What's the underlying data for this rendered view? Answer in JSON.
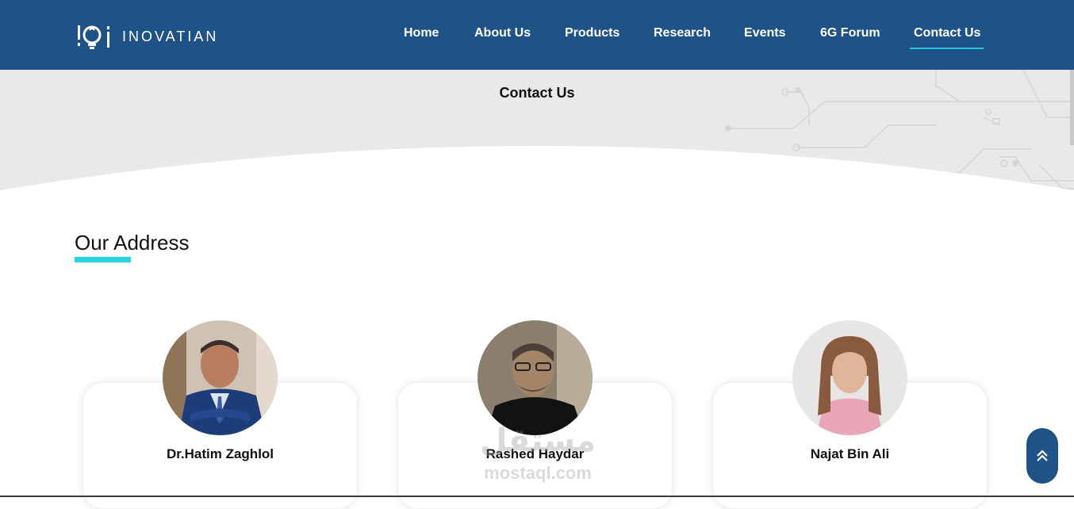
{
  "brand": {
    "name": "INOVATIAN",
    "logo_icon": "lightbulb-logo-icon"
  },
  "nav": {
    "items": [
      {
        "label": "Home"
      },
      {
        "label": "About Us"
      },
      {
        "label": "Products"
      },
      {
        "label": "Research"
      },
      {
        "label": "Events"
      },
      {
        "label": "6G Forum"
      },
      {
        "label": "Contact Us",
        "active": true
      }
    ]
  },
  "banner": {
    "title": "Contact Us"
  },
  "section": {
    "title": "Our Address"
  },
  "people": [
    {
      "name": "Dr.Hatim Zaghlol"
    },
    {
      "name": "Rashed Haydar"
    },
    {
      "name": "Najat Bin Ali"
    }
  ],
  "watermark": {
    "arabic": "مستقل",
    "latin": "mostaql.com"
  },
  "scroll_top": {
    "icon": "double-chevron-up-icon"
  },
  "colors": {
    "header": "#1f5388",
    "accent": "#29d3e0",
    "banner": "#e9e9e9"
  }
}
